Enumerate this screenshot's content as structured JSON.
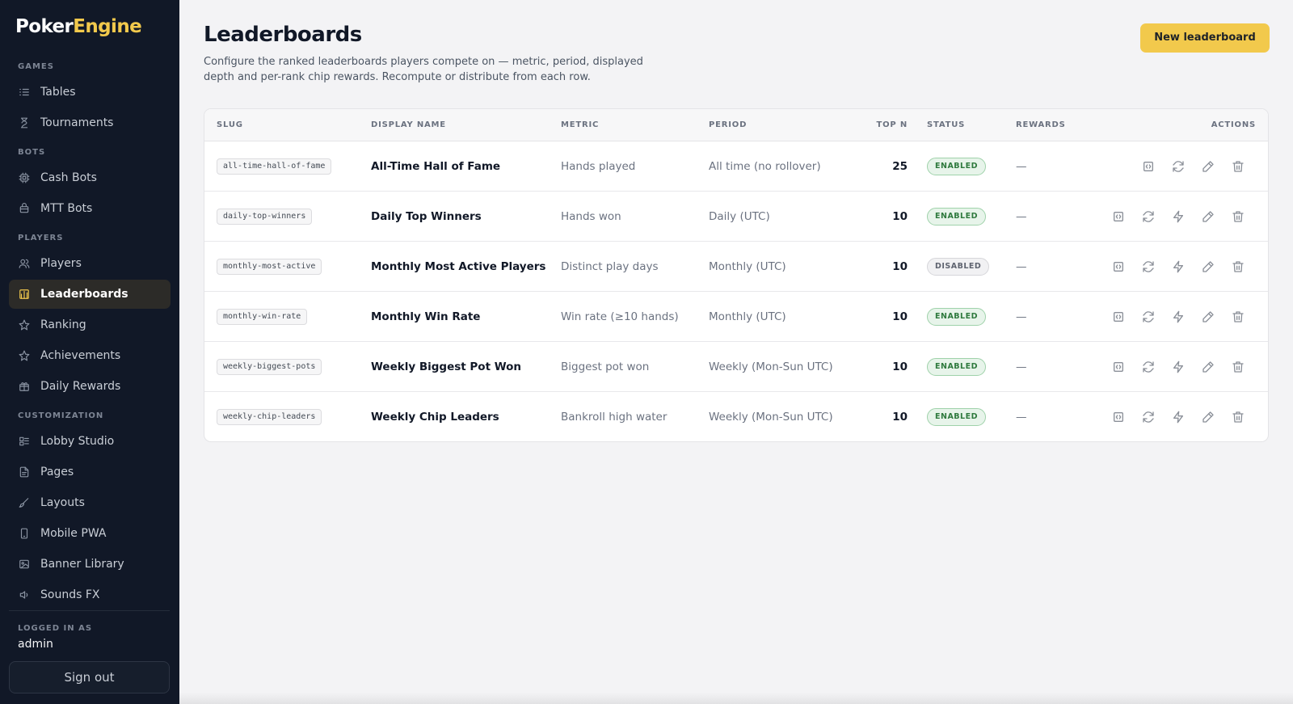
{
  "app": {
    "logo_part1": "Poker",
    "logo_part2": "Engine",
    "accent_color": "#f2c94c"
  },
  "sidebar": {
    "sections": [
      {
        "label": "GAMES",
        "items": [
          {
            "label": "Tables",
            "icon": "list-icon"
          },
          {
            "label": "Tournaments",
            "icon": "hourglass-icon"
          }
        ]
      },
      {
        "label": "BOTS",
        "items": [
          {
            "label": "Cash Bots",
            "icon": "cpu-icon"
          },
          {
            "label": "MTT Bots",
            "icon": "bot-icon"
          }
        ]
      },
      {
        "label": "PLAYERS",
        "items": [
          {
            "label": "Players",
            "icon": "users-icon"
          },
          {
            "label": "Leaderboards",
            "icon": "bar-chart-icon",
            "active": true
          },
          {
            "label": "Ranking",
            "icon": "star-icon"
          },
          {
            "label": "Achievements",
            "icon": "award-star-icon"
          },
          {
            "label": "Daily Rewards",
            "icon": "gift-icon"
          }
        ]
      },
      {
        "label": "CUSTOMIZATION",
        "items": [
          {
            "label": "Lobby Studio",
            "icon": "layout-icon"
          },
          {
            "label": "Pages",
            "icon": "file-icon"
          },
          {
            "label": "Layouts",
            "icon": "brush-icon"
          },
          {
            "label": "Mobile PWA",
            "icon": "smartphone-icon"
          },
          {
            "label": "Banner Library",
            "icon": "image-icon"
          },
          {
            "label": "Sounds FX",
            "icon": "sound-icon"
          }
        ]
      }
    ],
    "logged_in_label": "LOGGED IN AS",
    "username": "admin",
    "sign_out": "Sign out"
  },
  "page": {
    "title": "Leaderboards",
    "description": "Configure the ranked leaderboards players compete on — metric, period, displayed depth and per-rank chip rewards. Recompute or distribute from each row.",
    "new_button": "New leaderboard"
  },
  "table": {
    "columns": {
      "slug": "SLUG",
      "display_name": "DISPLAY NAME",
      "metric": "METRIC",
      "period": "PERIOD",
      "top_n": "TOP N",
      "status": "STATUS",
      "rewards": "REWARDS",
      "actions": "ACTIONS"
    },
    "rows": [
      {
        "slug": "all-time-hall-of-fame",
        "display_name": "All-Time Hall of Fame",
        "metric": "Hands played",
        "period": "All time (no rollover)",
        "top_n": "25",
        "status": "ENABLED",
        "rewards": "—",
        "distribute": false
      },
      {
        "slug": "daily-top-winners",
        "display_name": "Daily Top Winners",
        "metric": "Hands won",
        "period": "Daily (UTC)",
        "top_n": "10",
        "status": "ENABLED",
        "rewards": "—",
        "distribute": true
      },
      {
        "slug": "monthly-most-active",
        "display_name": "Monthly Most Active Players",
        "metric": "Distinct play days",
        "period": "Monthly (UTC)",
        "top_n": "10",
        "status": "DISABLED",
        "rewards": "—",
        "distribute": true
      },
      {
        "slug": "monthly-win-rate",
        "display_name": "Monthly Win Rate",
        "metric": "Win rate (≥10 hands)",
        "period": "Monthly (UTC)",
        "top_n": "10",
        "status": "ENABLED",
        "rewards": "—",
        "distribute": true
      },
      {
        "slug": "weekly-biggest-pots",
        "display_name": "Weekly Biggest Pot Won",
        "metric": "Biggest pot won",
        "period": "Weekly (Mon-Sun UTC)",
        "top_n": "10",
        "status": "ENABLED",
        "rewards": "—",
        "distribute": true
      },
      {
        "slug": "weekly-chip-leaders",
        "display_name": "Weekly Chip Leaders",
        "metric": "Bankroll high water",
        "period": "Weekly (Mon-Sun UTC)",
        "top_n": "10",
        "status": "ENABLED",
        "rewards": "—",
        "distribute": true
      }
    ]
  }
}
